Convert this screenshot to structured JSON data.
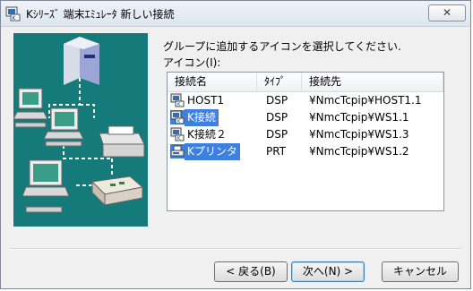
{
  "window": {
    "title": "Kｼﾘｰｽﾞ 端末ｴﾐｭﾚｰﾀ 新しい接続",
    "close_glyph": "✕"
  },
  "instructions": "グループに追加するアイコンを選択してください.",
  "list_caption": "アイコン(I):",
  "list": {
    "columns": [
      "接続名",
      "ﾀｲﾌﾟ",
      "接続先"
    ],
    "rows": [
      {
        "name": "HOST1",
        "type": "DSP",
        "target": "¥NmcTcpip¥HOST1.1",
        "icon": "terminal-icon",
        "selected": false
      },
      {
        "name": "K接続",
        "type": "DSP",
        "target": "¥NmcTcpip¥WS1.1",
        "icon": "terminal-icon",
        "selected": true
      },
      {
        "name": "K接続２",
        "type": "DSP",
        "target": "¥NmcTcpip¥WS1.3",
        "icon": "terminal-icon",
        "selected": false
      },
      {
        "name": "Kプリンタ",
        "type": "PRT",
        "target": "¥NmcTcpip¥WS1.2",
        "icon": "printer-icon",
        "selected": true
      }
    ]
  },
  "buttons": {
    "back": "< 戻る(B)",
    "next": "次へ(N) >",
    "cancel": "キャンセル"
  },
  "colors": {
    "illustration_bg": "#157b7a",
    "selection": "#3d80df"
  }
}
